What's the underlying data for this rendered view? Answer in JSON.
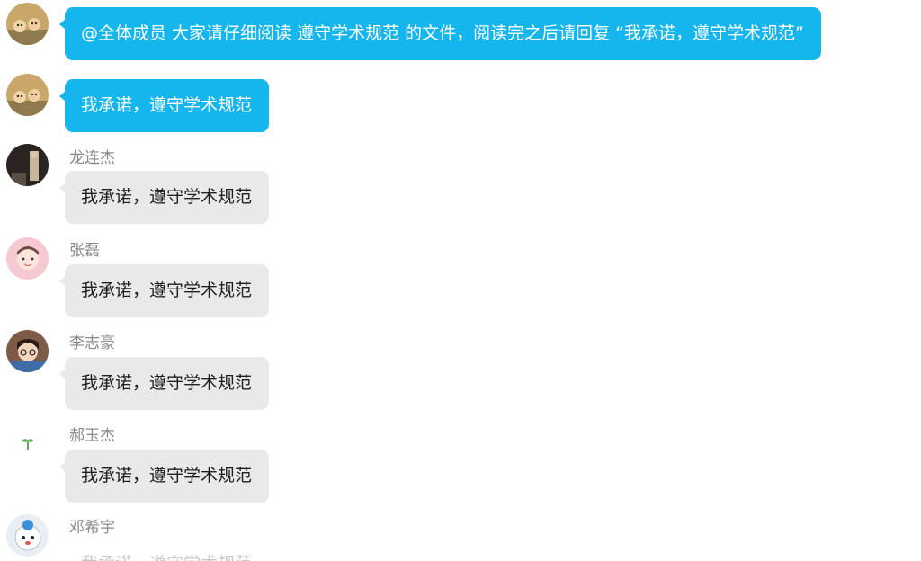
{
  "messages": [
    {
      "sender": "",
      "text": "@全体成员  大家请仔细阅读  遵守学术规范  的文件，阅读完之后请回复 “我承诺，遵守学术规范”",
      "self": true
    },
    {
      "sender": "",
      "text": "我承诺，遵守学术规范",
      "self": true
    },
    {
      "sender": "龙连杰",
      "text": "我承诺，遵守学术规范",
      "self": false
    },
    {
      "sender": "张磊",
      "text": "我承诺，遵守学术规范",
      "self": false
    },
    {
      "sender": "李志豪",
      "text": "我承诺，遵守学术规范",
      "self": false
    },
    {
      "sender": "郝玉杰",
      "text": "我承诺，遵守学术规范",
      "self": false
    },
    {
      "sender": "邓希宇",
      "text": "我承诺，遵守学术规范",
      "self": false
    }
  ],
  "colors": {
    "self_bubble": "#15b5ee",
    "other_bubble": "#e9e9e9",
    "sender_name": "#8a8a8a"
  },
  "icons": {
    "avatar_self": "photo-avatar-icon",
    "avatar_other": "user-avatar-icon"
  }
}
